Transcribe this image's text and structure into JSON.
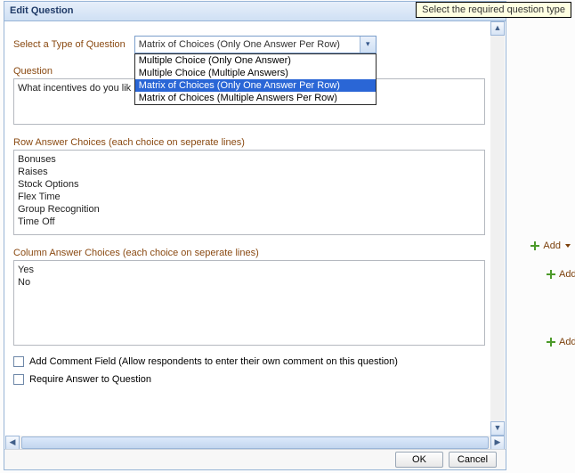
{
  "dialog": {
    "title": "Edit Question"
  },
  "tooltip": {
    "text": "Select the required question type"
  },
  "type_select": {
    "label": "Select a Type of Question",
    "selected": "Matrix of Choices (Only One Answer Per Row)",
    "options": [
      "Multiple Choice (Only One Answer)",
      "Multiple Choice (Multiple Answers)",
      "Matrix of Choices (Only One Answer Per Row)",
      "Matrix of Choices (Multiple Answers Per Row)"
    ],
    "highlighted_index": 2
  },
  "question": {
    "label": "Question",
    "value": "What incentives do you lik"
  },
  "row_choices": {
    "label": "Row Answer Choices (each choice on seperate lines)",
    "values": [
      "Bonuses",
      "Raises",
      "Stock Options",
      "Flex Time",
      "Group Recognition",
      "Time Off"
    ]
  },
  "col_choices": {
    "label": "Column Answer Choices (each choice on seperate lines)",
    "values": [
      "Yes",
      "No"
    ]
  },
  "comment_chk": {
    "label": "Add Comment Field (Allow respondents to enter their own comment on this question)"
  },
  "require_chk": {
    "label": "Require Answer to Question"
  },
  "footer": {
    "ok": "OK",
    "cancel": "Cancel"
  },
  "side": {
    "add1": "Add",
    "add2": "Add",
    "add3": "Add"
  }
}
